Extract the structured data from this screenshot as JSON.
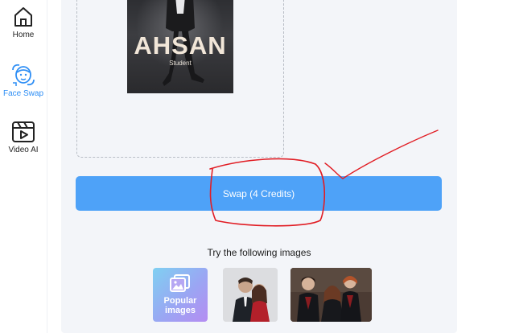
{
  "sidebar": {
    "items": [
      {
        "label": "Home",
        "icon": "home-icon",
        "active": false
      },
      {
        "label": "Face Swap",
        "icon": "face-swap-icon",
        "active": true
      },
      {
        "label": "Video AI",
        "icon": "video-icon",
        "active": false
      }
    ]
  },
  "upload": {
    "poster_name": "AHSAN",
    "poster_subtitle": "Student"
  },
  "swap_button": {
    "label": "Swap (4 Credits)"
  },
  "examples": {
    "title": "Try the following images",
    "popular_label_1": "Popular",
    "popular_label_2": "images"
  },
  "colors": {
    "accent": "#4ea2f8",
    "active_nav": "#2f8ff5",
    "panel_bg": "#f3f5f9",
    "annotation": "#e11d24"
  }
}
